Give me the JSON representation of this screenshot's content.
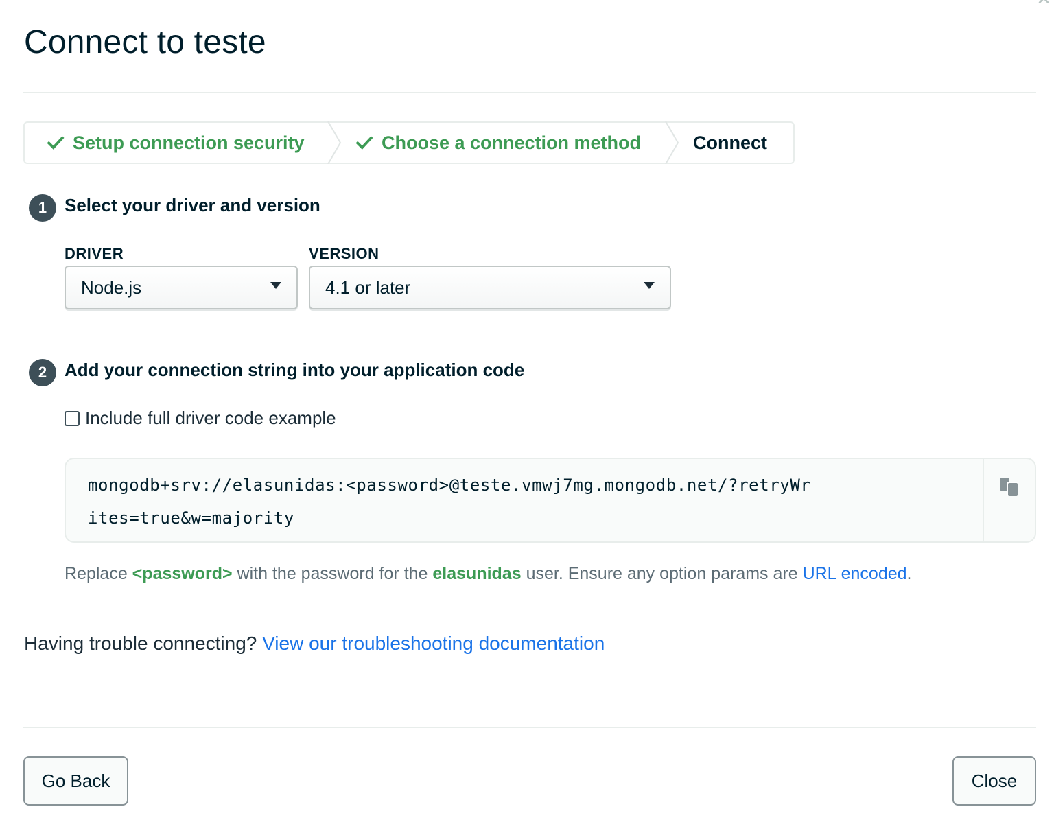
{
  "modal": {
    "title": "Connect to teste",
    "close_icon": "close-icon"
  },
  "stepper": {
    "steps": [
      {
        "label": "Setup connection security",
        "state": "done"
      },
      {
        "label": "Choose a connection method",
        "state": "done"
      },
      {
        "label": "Connect",
        "state": "current"
      }
    ]
  },
  "section1": {
    "number": "1",
    "title": "Select your driver and version",
    "driver_label": "DRIVER",
    "driver_value": "Node.js",
    "version_label": "VERSION",
    "version_value": "4.1 or later"
  },
  "section2": {
    "number": "2",
    "title": "Add your connection string into your application code",
    "checkbox_label": "Include full driver code example",
    "checkbox_checked": false,
    "connection_string": "mongodb+srv://elasunidas:<password>@teste.vmwj7mg.mongodb.net/?retryWrites=true&w=majority",
    "copy_icon": "copy-icon"
  },
  "note": {
    "prefix": "Replace ",
    "password_token": "<password>",
    "middle": " with the password for the ",
    "username": "elasunidas",
    "suffix": " user. Ensure any option params are ",
    "link_text": "URL encoded",
    "end": "."
  },
  "trouble": {
    "text": "Having trouble connecting? ",
    "link_text": "View our troubleshooting documentation"
  },
  "footer": {
    "back_label": "Go Back",
    "close_label": "Close"
  },
  "colors": {
    "success_green": "#3d9b54",
    "link_blue": "#1a73e8",
    "badge_gray": "#3d4f58",
    "title_ink": "#001e2b"
  }
}
